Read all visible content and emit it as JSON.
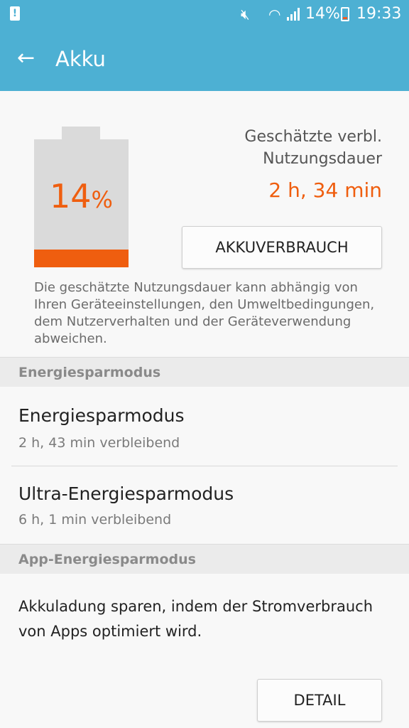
{
  "status_bar": {
    "battery_percent": "14%",
    "time": "19:33",
    "icons": [
      "warning-icon",
      "mute-icon",
      "wifi-icon",
      "signal-icon",
      "battery-icon"
    ]
  },
  "app_bar": {
    "title": "Akku",
    "back_icon": "arrow-back-icon"
  },
  "battery": {
    "percent_value": "14",
    "percent_symbol": "%",
    "level_fraction": 0.14,
    "accent_color": "#ef5e0f",
    "estimate_label": "Geschätzte verbl. Nutzungsdauer",
    "estimate_value": "2 h, 34 min",
    "usage_button": "AKKUVERBRAUCH",
    "disclaimer": "Die geschätzte Nutzungsdauer kann abhängig von Ihren Geräteeinstellungen, den Umweltbedingungen, dem Nutzerverhalten und der Geräteverwendung abweichen."
  },
  "power_saving": {
    "header": "Energiesparmodus",
    "items": [
      {
        "title": "Energiesparmodus",
        "subtitle": "2 h, 43 min verbleibend"
      },
      {
        "title": "Ultra-Energiesparmodus",
        "subtitle": "6 h, 1 min verbleibend"
      }
    ]
  },
  "app_power_saving": {
    "header": "App-Energiesparmodus",
    "description": "Akkuladung sparen, indem der Stromverbrauch von Apps optimiert wird.",
    "detail_button": "DETAIL"
  },
  "colors": {
    "app_bar": "#4db0d3",
    "accent": "#ef5e0f"
  }
}
